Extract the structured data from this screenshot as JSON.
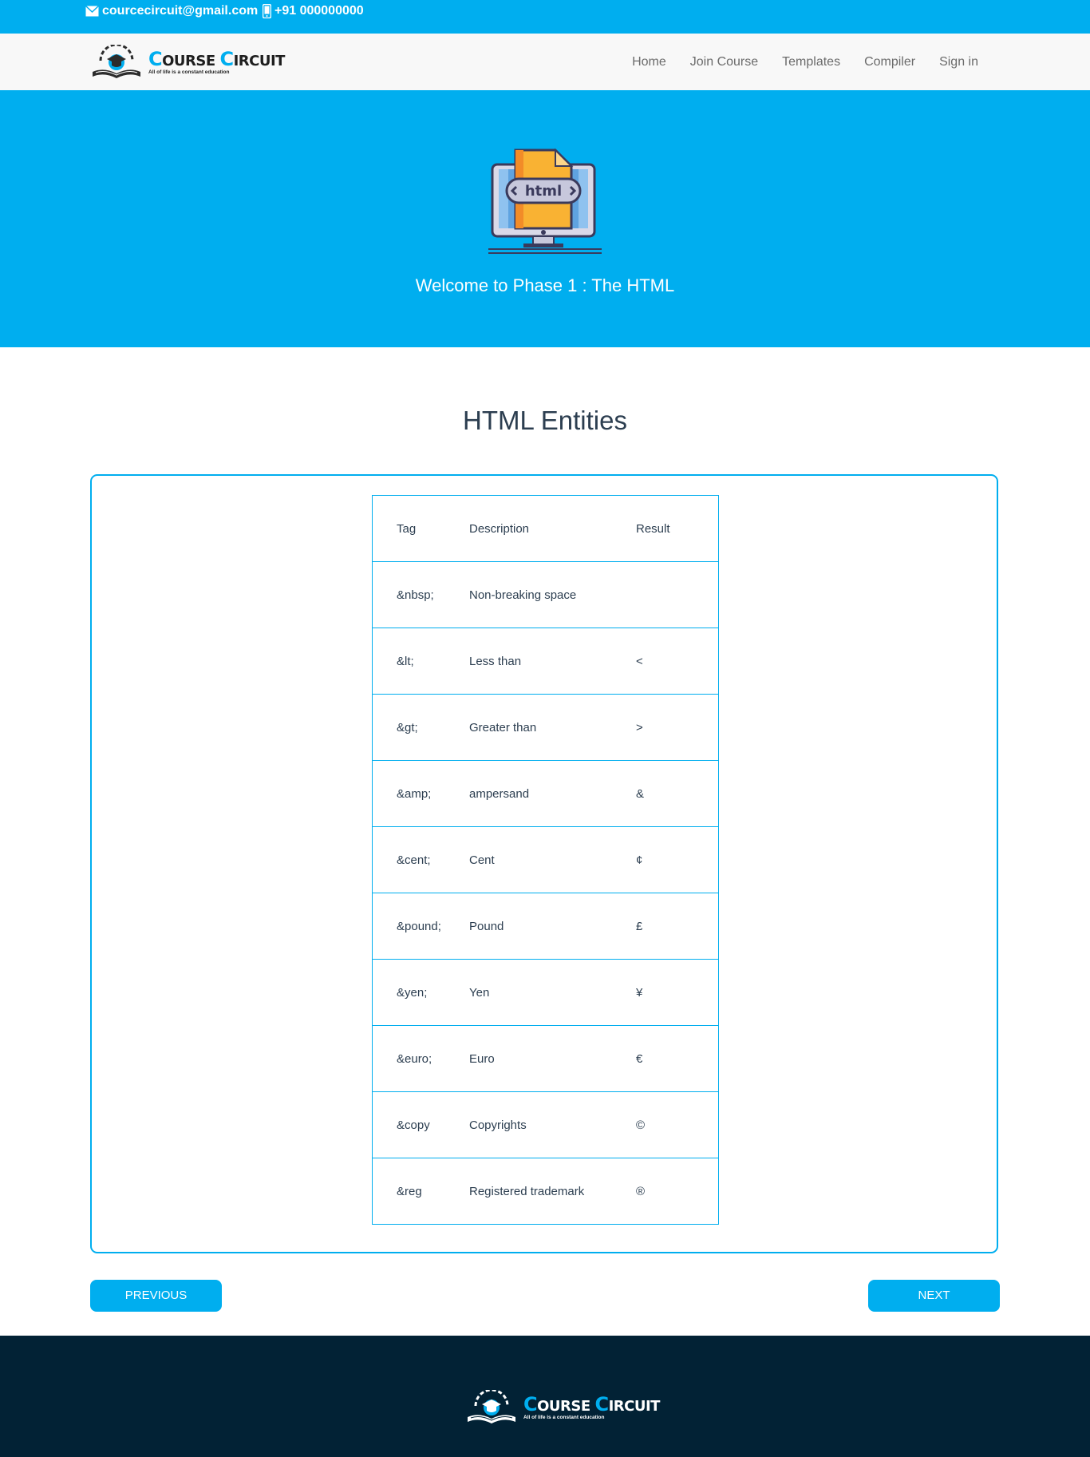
{
  "topbar": {
    "email": "courcecircuit@gmail.com",
    "phone": "+91 000000000"
  },
  "brand": {
    "name_first_cap": "C",
    "name_first_rest": "OURSE ",
    "name_second_cap": "C",
    "name_second_rest": "IRCUIT",
    "tagline": "All of life is a constant education"
  },
  "nav": {
    "items": [
      "Home",
      "Join Course",
      "Templates",
      "Compiler",
      "Sign in"
    ]
  },
  "hero": {
    "badge_text": "html",
    "title": "Welcome to Phase 1 : The HTML"
  },
  "section": {
    "title": "HTML Entities"
  },
  "table": {
    "headers": [
      "Tag",
      "Description",
      "Result"
    ],
    "rows": [
      [
        "&nbsp;",
        "Non-breaking space",
        ""
      ],
      [
        "&lt;",
        "Less than",
        "<"
      ],
      [
        "&gt;",
        "Greater than",
        ">"
      ],
      [
        "&amp;",
        "ampersand",
        "&"
      ],
      [
        "&cent;",
        "Cent",
        "¢"
      ],
      [
        "&pound;",
        "Pound",
        "£"
      ],
      [
        "&yen;",
        "Yen",
        "¥"
      ],
      [
        "&euro;",
        "Euro",
        "€"
      ],
      [
        "&copy",
        "Copyrights",
        "©"
      ],
      [
        "&reg",
        "Registered trademark",
        "®"
      ]
    ]
  },
  "buttons": {
    "previous": "PREVIOUS",
    "next": "NEXT"
  },
  "colors": {
    "accent": "#00aeef",
    "footer_bg": "#022235",
    "text": "#2c3e50"
  },
  "icons": {
    "email": "envelope-icon",
    "phone": "mobile-phone-icon",
    "hero": "html-monitor-icon"
  }
}
